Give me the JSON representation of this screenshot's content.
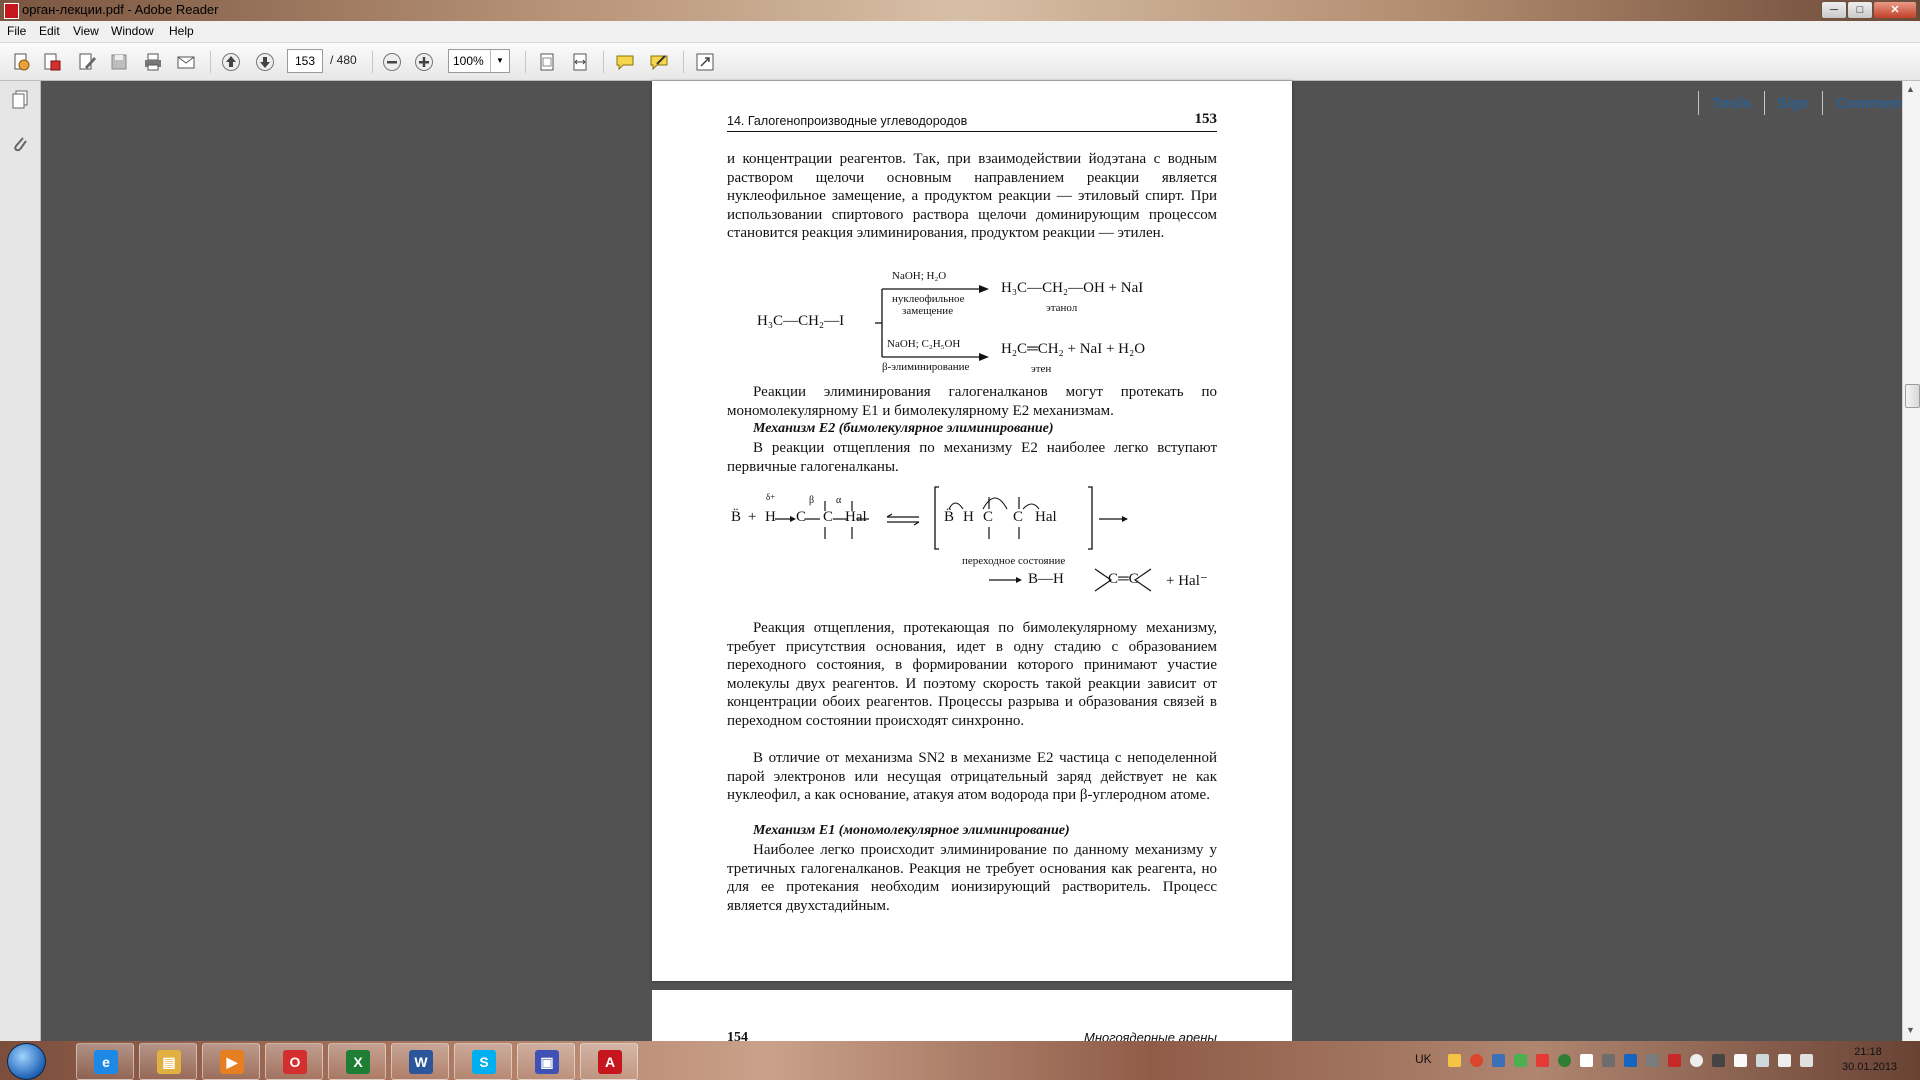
{
  "window": {
    "title": "орган-лекции.pdf - Adobe Reader",
    "minimize_label": "─",
    "maximize_label": "□",
    "close_label": "✕"
  },
  "menu": [
    "File",
    "Edit",
    "View",
    "Window",
    "Help"
  ],
  "toolbar": {
    "page_current": "153",
    "page_total": "/ 480",
    "zoom": "100%",
    "tools_label": "Tools",
    "sign_label": "Sign",
    "comment_label": "Comment"
  },
  "document": {
    "running_head_left": "14. Галогенопроизводные углеводородов",
    "page_number": "153",
    "p1": "и концентрации реагентов. Так, при взаимодействии йодэтана с водным раствором щелочи основным направлением реакции является нуклеофильное замещение, а продуктом реакции — этиловый спирт. При использовании спиртового раствора щелочи доминирующим процессом становится реакция элиминирования, продуктом реакции — этилен.",
    "scheme1": {
      "reactant": "H₃C—CH₂—I",
      "upper_reagent": "NaOH; H₂O",
      "upper_condition_1": "нуклеофильное",
      "upper_condition_2": "замещение",
      "upper_product": "H₃C—CH₂—OH + NaI",
      "upper_product_name": "этанол",
      "lower_reagent": "NaOH; C₂H₅OH",
      "lower_condition": "β-элиминирование",
      "lower_product": "H₂C═CH₂ + NaI + H₂O",
      "lower_product_name": "этен"
    },
    "p2": "Реакции элиминирования галогеналканов могут протекать по мономолекулярному E1 и бимолекулярному E2 механизмам.",
    "h1": "Механизм E2 (бимолекулярное элиминирование)",
    "p3": "В реакции отщепления по механизму E2 наиболее легко вступают первичные галогеналканы.",
    "scheme2": {
      "base": "B̈",
      "plus": "+",
      "delta": "δ+",
      "h_atom": "H",
      "carbon": "C",
      "beta": "β",
      "alpha": "α",
      "hal": "Hal",
      "ts_base": "B̈",
      "ts_h": "H",
      "ts_c": "C",
      "ts_hal": "Hal",
      "ts_caption": "переходное состояние",
      "product_bh": "B—H",
      "product_alkene": "C═C",
      "product_hal": "+ Hal⁻"
    },
    "p4": "Реакция отщепления, протекающая по бимолекулярному механизму, требует присутствия основания, идет в одну стадию с образованием переходного состояния, в формировании которого принимают участие молекулы двух реагентов. И поэтому скорость такой реакции зависит от концентрации обоих реагентов. Процессы разрыва и образования связей в переходном состоянии происходят синхронно.",
    "p5": "В отличие от механизма SN2 в механизме E2 частица с неподеленной парой электронов или несущая отрицательный заряд действует не как нуклеофил, а как основание, атакуя атом водорода при β-углеродном атоме.",
    "h2": "Механизм E1 (мономолекулярное элиминирование)",
    "p6": "Наиболее легко происходит элиминирование по данному механизму у третичных галогеналканов. Реакция не требует основания как реагента, но для ее протекания необходим ионизирующий растворитель. Процесс является двухстадийным.",
    "next_page_number": "154",
    "next_running_head": "Многоядерные арены"
  },
  "taskbar": {
    "apps": [
      {
        "name": "ie",
        "glyph": "e",
        "color": "#1e88e5"
      },
      {
        "name": "explorer",
        "glyph": "▤",
        "color": "#e0b040"
      },
      {
        "name": "media",
        "glyph": "▶",
        "color": "#e67e22"
      },
      {
        "name": "opera",
        "glyph": "O",
        "color": "#d32f2f"
      },
      {
        "name": "excel",
        "glyph": "X",
        "color": "#1e7e34"
      },
      {
        "name": "word",
        "glyph": "W",
        "color": "#2b579a"
      },
      {
        "name": "skype",
        "glyph": "S",
        "color": "#00aff0"
      },
      {
        "name": "save",
        "glyph": "▣",
        "color": "#3f51b5"
      },
      {
        "name": "acrobat",
        "glyph": "A",
        "color": "#c4161c"
      }
    ],
    "lang": "UK",
    "time": "21:18",
    "date": "30.01.2013"
  }
}
